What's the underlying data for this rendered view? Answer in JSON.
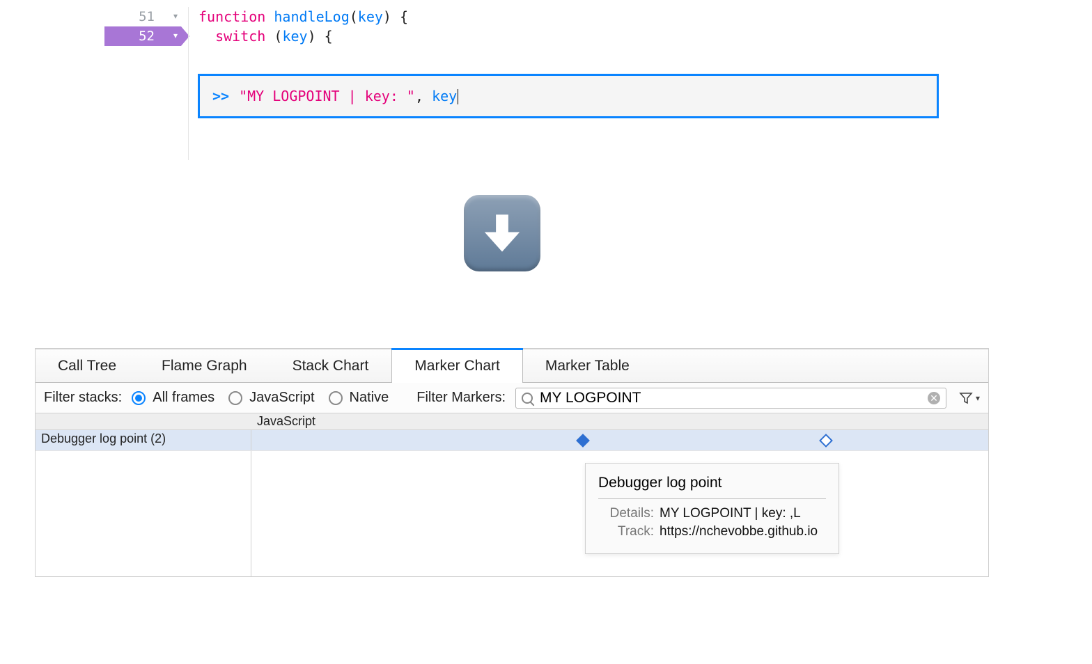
{
  "editor": {
    "lines": [
      {
        "num": "51",
        "fold": true,
        "active": false,
        "code": {
          "func_kw": "function",
          "func_name": "handleLog",
          "paren_open": "(",
          "param": "key",
          "paren_close": ")",
          "brace": " {"
        }
      },
      {
        "num": "52",
        "fold": true,
        "active": true,
        "code": {
          "indent": "  ",
          "switch_kw": "switch",
          "paren_open": " (",
          "param": "key",
          "paren_close": ")",
          "brace": " {"
        }
      }
    ],
    "logpoint": {
      "prompt": ">>",
      "string_part": "\"MY LOGPOINT | key: \"",
      "comma": ", ",
      "var_part": "key"
    }
  },
  "profiler": {
    "tabs": [
      "Call Tree",
      "Flame Graph",
      "Stack Chart",
      "Marker Chart",
      "Marker Table"
    ],
    "active_tab": 3,
    "filter_stacks_label": "Filter stacks:",
    "radios": [
      {
        "label": "All frames",
        "checked": true
      },
      {
        "label": "JavaScript",
        "checked": false
      },
      {
        "label": "Native",
        "checked": false
      }
    ],
    "filter_markers_label": "Filter Markers:",
    "search_value": "MY LOGPOINT",
    "chart_header": "JavaScript",
    "row_label": "Debugger log point (2)",
    "markers": [
      {
        "pct": 45,
        "style": "solid"
      },
      {
        "pct": 78,
        "style": "hollow"
      }
    ],
    "tooltip": {
      "title": "Debugger log point",
      "details_key": "Details:",
      "details_val": "MY LOGPOINT | key: ,L",
      "track_key": "Track:",
      "track_val": "https://nchevobbe.github.io"
    }
  }
}
